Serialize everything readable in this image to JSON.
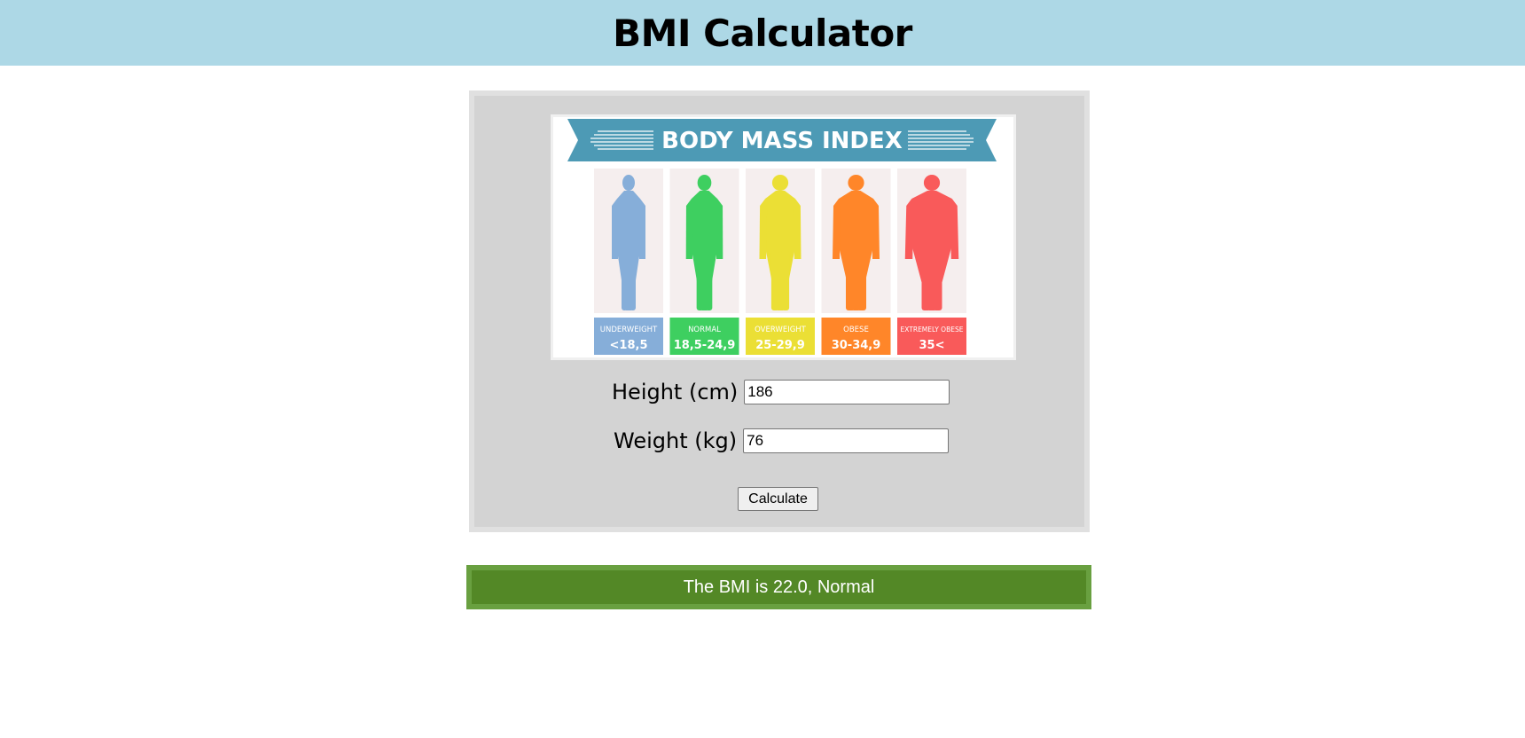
{
  "header": {
    "title": "BMI Calculator"
  },
  "infographic": {
    "title": "BODY MASS INDEX",
    "categories": [
      {
        "name": "UNDERWEIGHT",
        "range": "<18,5",
        "color": "#86aed9"
      },
      {
        "name": "NORMAL",
        "range": "18,5-24,9",
        "color": "#3ecf60"
      },
      {
        "name": "OVERWEIGHT",
        "range": "25-29,9",
        "color": "#ebdf35"
      },
      {
        "name": "OBESE",
        "range": "30-34,9",
        "color": "#ff8629"
      },
      {
        "name": "EXTREMELY OBESE",
        "range": "35<",
        "color": "#f95a5a"
      }
    ],
    "banner_color": "#4d9ab5",
    "panel_color": "#f5eeee"
  },
  "form": {
    "height_label": "Height (cm)",
    "height_value": "186",
    "weight_label": "Weight (kg)",
    "weight_value": "76",
    "calculate_label": "Calculate"
  },
  "result": {
    "text": "The BMI is 22.0, Normal"
  }
}
